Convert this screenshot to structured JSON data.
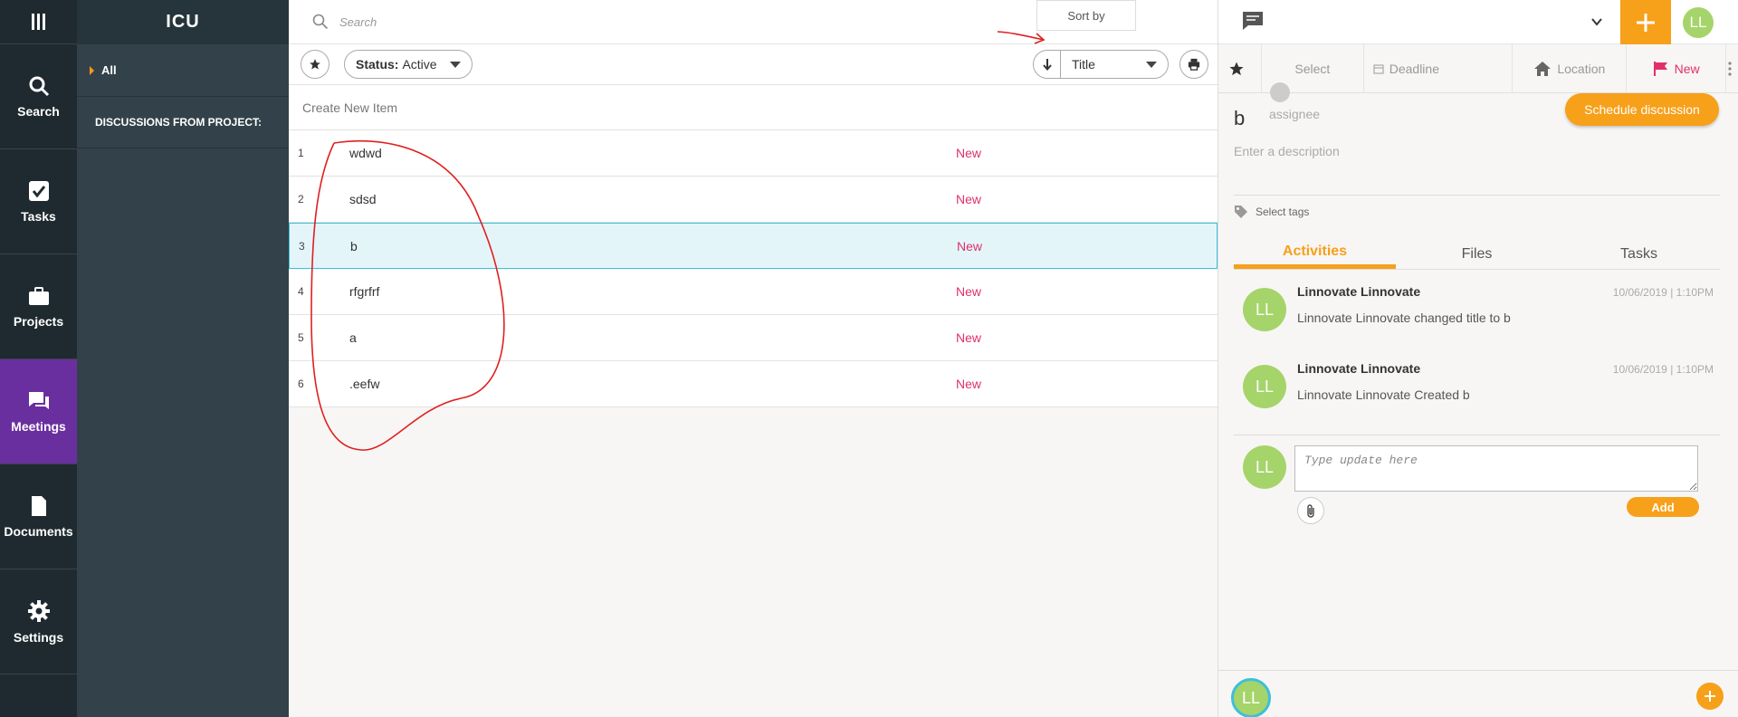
{
  "rail": {
    "items": [
      {
        "label": "Search",
        "icon": "search-icon"
      },
      {
        "label": "Tasks",
        "icon": "check-icon"
      },
      {
        "label": "Projects",
        "icon": "briefcase-icon"
      },
      {
        "label": "Meetings",
        "icon": "chat-icon"
      },
      {
        "label": "Documents",
        "icon": "document-icon"
      },
      {
        "label": "Settings",
        "icon": "gear-icon"
      }
    ],
    "active": "Meetings",
    "active_color": "#6a2f9e"
  },
  "subnav": {
    "title": "ICU",
    "all_label": "All",
    "section_label": "DISCUSSIONS FROM PROJECT:"
  },
  "list": {
    "search_placeholder": "Search",
    "sort_tooltip": "Sort by",
    "status_label": "Status:",
    "status_value": "Active",
    "sort_field": "Title",
    "create_new": "Create New Item",
    "rows": [
      {
        "num": "1",
        "title": "wdwd",
        "status": "New"
      },
      {
        "num": "2",
        "title": "sdsd",
        "status": "New"
      },
      {
        "num": "3",
        "title": "b",
        "status": "New"
      },
      {
        "num": "4",
        "title": "rfgrfrf",
        "status": "New"
      },
      {
        "num": "5",
        "title": "a",
        "status": "New"
      },
      {
        "num": "6",
        "title": ".eefw",
        "status": "New"
      }
    ],
    "selected_row": "3",
    "status_color": "#e0306b"
  },
  "detail": {
    "avatar_initials": "LL",
    "fields": {
      "select": "Select",
      "deadline": "Deadline",
      "location": "Location",
      "status": "New"
    },
    "title": "b",
    "assignee_placeholder": "assignee",
    "schedule_button": "Schedule discussion",
    "description_placeholder": "Enter a description",
    "tags_placeholder": "Select tags",
    "tabs": [
      "Activities",
      "Files",
      "Tasks"
    ],
    "active_tab": "Activities",
    "activities": [
      {
        "initials": "LL",
        "name": "Linnovate Linnovate",
        "time": "10/06/2019 | 1:10PM",
        "text": "Linnovate Linnovate changed title to b"
      },
      {
        "initials": "LL",
        "name": "Linnovate Linnovate",
        "time": "10/06/2019 | 1:10PM",
        "text": "Linnovate Linnovate Created b"
      }
    ],
    "update_initials": "LL",
    "update_placeholder": "Type update here",
    "add_button": "Add",
    "bottom_initials": "LL",
    "accent_color": "#f7a01a"
  }
}
